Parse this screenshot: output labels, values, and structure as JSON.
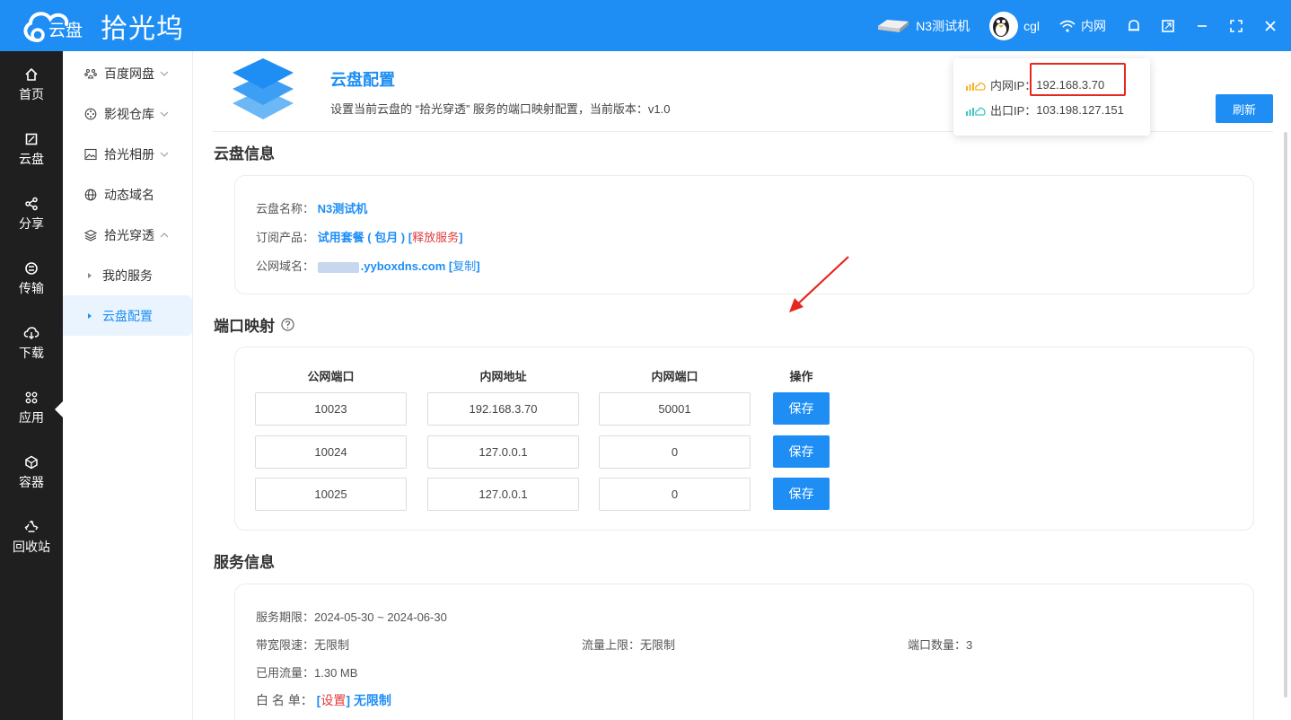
{
  "header": {
    "app_name": "拾光坞",
    "logo_text": "云盘",
    "device": "N3测试机",
    "user": "cgl",
    "network": "内网"
  },
  "rail": {
    "items": [
      {
        "label": "首页"
      },
      {
        "label": "云盘"
      },
      {
        "label": "分享"
      },
      {
        "label": "传输"
      },
      {
        "label": "下载"
      },
      {
        "label": "应用"
      },
      {
        "label": "容器"
      },
      {
        "label": "回收站"
      }
    ]
  },
  "submenu": {
    "items": [
      {
        "label": "百度网盘"
      },
      {
        "label": "影视仓库"
      },
      {
        "label": "拾光相册"
      },
      {
        "label": "动态域名"
      },
      {
        "label": "拾光穿透"
      }
    ],
    "sub_items": [
      {
        "label": "我的服务"
      },
      {
        "label": "云盘配置"
      }
    ]
  },
  "config": {
    "title": "云盘配置",
    "description": "设置当前云盘的 “拾光穿透” 服务的端口映射配置，当前版本：v1.0",
    "refresh_label": "刷新"
  },
  "ip_popup": {
    "lan_label": "内网IP：",
    "lan_ip": "192.168.3.70",
    "wan_label": "出口IP：",
    "wan_ip": "103.198.127.151"
  },
  "cloud_info": {
    "section_title": "云盘信息",
    "name_label": "云盘名称：",
    "name_value": "N3测试机",
    "product_label": "订阅产品：",
    "product_value": "试用套餐 ( 包月 )",
    "release_open": "[",
    "release_link": "释放服务",
    "release_close": "]",
    "domain_label": "公网域名：",
    "domain_value": ".yyboxdns.com",
    "copy_open": "[",
    "copy_link": "复制",
    "copy_close": "]"
  },
  "port_mapping": {
    "section_title": "端口映射",
    "headers": {
      "public_port": "公网端口",
      "lan_address": "内网地址",
      "lan_port": "内网端口",
      "action": "操作"
    },
    "rows": [
      {
        "public_port": "10023",
        "lan_address": "192.168.3.70",
        "lan_port": "50001",
        "save": "保存"
      },
      {
        "public_port": "10024",
        "lan_address": "127.0.0.1",
        "lan_port": "0",
        "save": "保存"
      },
      {
        "public_port": "10025",
        "lan_address": "127.0.0.1",
        "lan_port": "0",
        "save": "保存"
      }
    ]
  },
  "service_info": {
    "section_title": "服务信息",
    "period_label": "服务期限：",
    "period_value": "2024-05-30 ~ 2024-06-30",
    "bandwidth_label": "带宽限速：",
    "bandwidth_value": "无限制",
    "traffic_label": "流量上限：",
    "traffic_value": "无限制",
    "ports_label": "端口数量：",
    "ports_value": "3",
    "used_label": "已用流量：",
    "used_value": "1.30 MB",
    "whitelist_label": "白 名 单：",
    "whitelist_open": "[",
    "whitelist_link": "设置",
    "whitelist_close": "]",
    "whitelist_value": "无限制"
  },
  "colors": {
    "accent": "#1e8ef5",
    "rail_bg": "#1f1f1f",
    "highlight": "#e8261f",
    "danger": "#e33b3b"
  }
}
